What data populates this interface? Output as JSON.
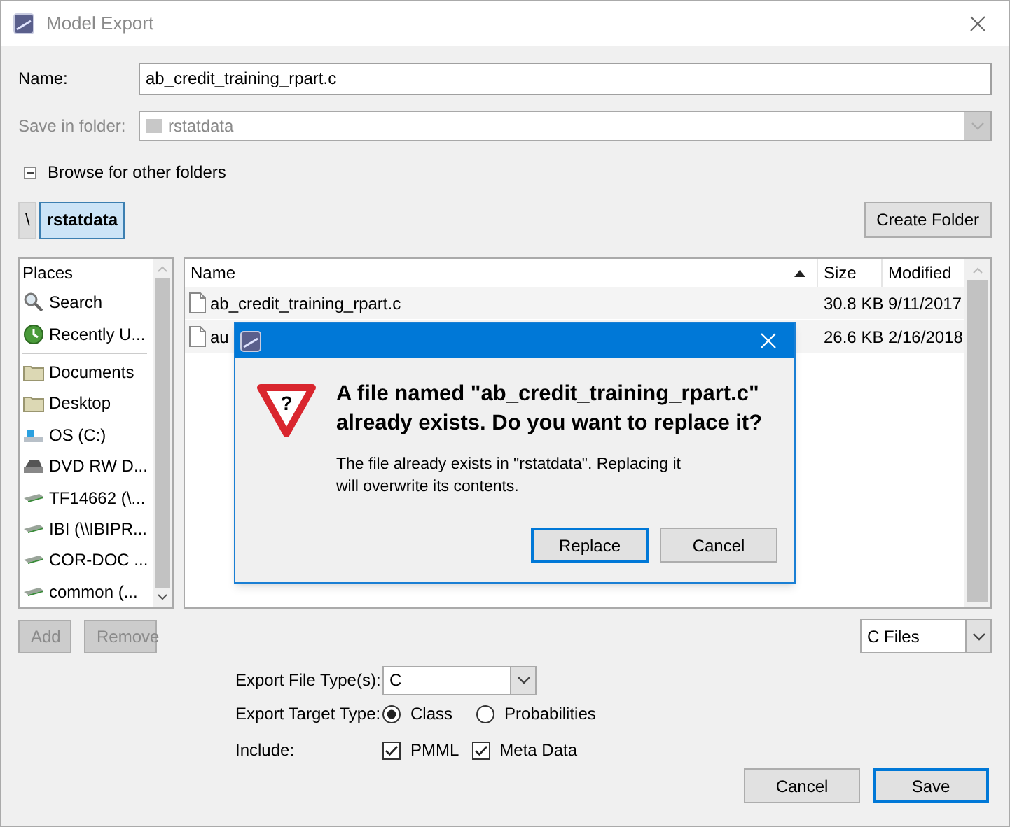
{
  "window": {
    "title": "Model Export"
  },
  "name_field": {
    "label": "Name:",
    "value": "ab_credit_training_rpart.c"
  },
  "folder_field": {
    "label": "Save in folder:",
    "value": "rstatdata",
    "disabled": true
  },
  "browse_toggle": {
    "label": "Browse for other folders",
    "expanded": true
  },
  "breadcrumb": [
    {
      "label": "\\",
      "selected": false
    },
    {
      "label": "rstatdata",
      "selected": true
    }
  ],
  "create_folder_button": "Create Folder",
  "places": {
    "header": "Places",
    "items": [
      {
        "label": "Search",
        "kind": "search"
      },
      {
        "label": "Recently U...",
        "kind": "recent"
      },
      {
        "label": "Documents",
        "kind": "folder"
      },
      {
        "label": "Desktop",
        "kind": "folder"
      },
      {
        "label": "OS (C:)",
        "kind": "drive"
      },
      {
        "label": "DVD RW D...",
        "kind": "dvd"
      },
      {
        "label": "TF14662 (\\...",
        "kind": "network"
      },
      {
        "label": "IBI (\\\\IBIPR...",
        "kind": "network"
      },
      {
        "label": "COR-DOC ...",
        "kind": "network"
      },
      {
        "label": "common (...",
        "kind": "network"
      }
    ]
  },
  "places_buttons": [
    {
      "label": "Add",
      "disabled": true
    },
    {
      "label": "Remove",
      "disabled": true
    }
  ],
  "file_table": {
    "columns": [
      "Name",
      "Size",
      "Modified"
    ],
    "rows": [
      {
        "name": "ab_credit_training_rpart.c",
        "size": "30.8 KB",
        "modified": "9/11/2017"
      },
      {
        "name": "au",
        "size": "26.6 KB",
        "modified": "2/16/2018"
      }
    ]
  },
  "filter": {
    "value": "C Files"
  },
  "export_file_type": {
    "label": "Export File Type(s):",
    "value": "C"
  },
  "export_target_type": {
    "label": "Export Target Type:",
    "options": [
      {
        "label": "Class",
        "selected": true
      },
      {
        "label": "Probabilities",
        "selected": false
      }
    ]
  },
  "include": {
    "label": "Include:",
    "options": [
      {
        "label": "PMML",
        "checked": true
      },
      {
        "label": "Meta Data",
        "checked": true
      }
    ]
  },
  "buttons": [
    {
      "label": "Cancel",
      "default": false
    },
    {
      "label": "Save",
      "default": true
    }
  ],
  "confirm_dialog": {
    "warning_glyph": "?",
    "heading": "A file named \"ab_credit_training_rpart.c\" already exists.  Do you want to replace it?",
    "message": "The file already exists in \"rstatdata\".  Replacing it will overwrite its contents.",
    "buttons": [
      {
        "label": "Replace",
        "default": true
      },
      {
        "label": "Cancel",
        "default": false
      }
    ]
  }
}
